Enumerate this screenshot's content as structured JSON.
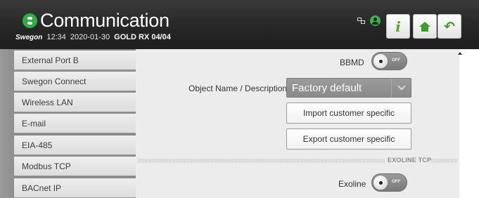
{
  "header": {
    "title": "Communication",
    "brand": "Swegon",
    "time": "12:34",
    "date": "2020-01-30",
    "unit": "GOLD RX 04/04",
    "icons": [
      "network-icon",
      "user-icon"
    ],
    "buttons": [
      {
        "name": "info-button",
        "icon": "info-icon"
      },
      {
        "name": "home-button",
        "icon": "home-icon"
      },
      {
        "name": "back-button",
        "icon": "back-arrow-icon"
      }
    ],
    "accent_color": "#3f9d2d"
  },
  "sidebar": {
    "items": [
      {
        "label": "External Port B"
      },
      {
        "label": "Swegon Connect"
      },
      {
        "label": "Wireless LAN"
      },
      {
        "label": "E-mail"
      },
      {
        "label": "EIA-485"
      },
      {
        "label": "Modbus TCP"
      },
      {
        "label": "BACnet IP"
      }
    ]
  },
  "main": {
    "bbmd": {
      "label": "BBMD",
      "state": "OFF"
    },
    "object_name": {
      "label": "Object Name / Description",
      "value": "Factory default"
    },
    "import_button": "Import customer specific",
    "export_button": "Export customer specific",
    "section": {
      "title": "EXOLINE TCP"
    },
    "exoline": {
      "label": "Exoline",
      "state": "OFF"
    }
  }
}
